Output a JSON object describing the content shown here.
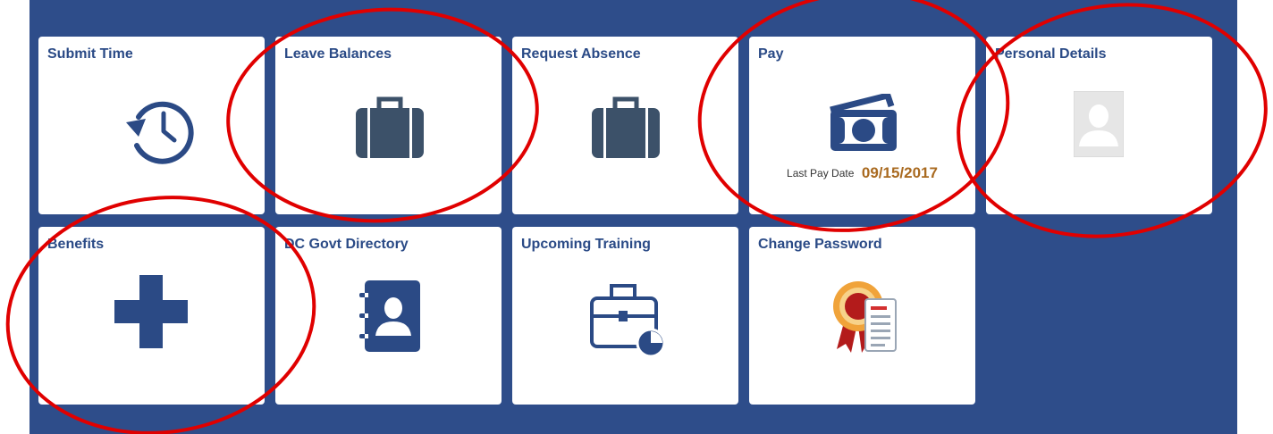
{
  "tiles": {
    "submit_time": {
      "title": "Submit Time",
      "icon": "history-clock-icon"
    },
    "leave_balances": {
      "title": "Leave Balances",
      "icon": "briefcase-icon"
    },
    "request_absence": {
      "title": "Request Absence",
      "icon": "briefcase-icon"
    },
    "pay": {
      "title": "Pay",
      "icon": "money-icon",
      "last_pay_label": "Last Pay Date",
      "last_pay_date": "09/15/2017"
    },
    "personal_details": {
      "title": "Personal Details",
      "icon": "person-placeholder-icon"
    },
    "benefits": {
      "title": "Benefits",
      "icon": "plus-icon"
    },
    "dc_directory": {
      "title": "DC Govt Directory",
      "icon": "address-book-icon"
    },
    "upcoming_training": {
      "title": "Upcoming Training",
      "icon": "training-case-icon"
    },
    "change_password": {
      "title": "Change Password",
      "icon": "certificate-icon"
    }
  },
  "colors": {
    "panel_bg": "#2e4d8a",
    "tile_title": "#2a4a86",
    "icon_dark": "#3c5169",
    "icon_blue": "#2b4a85",
    "pay_date": "#a96a20",
    "annotation": "#e00000"
  }
}
